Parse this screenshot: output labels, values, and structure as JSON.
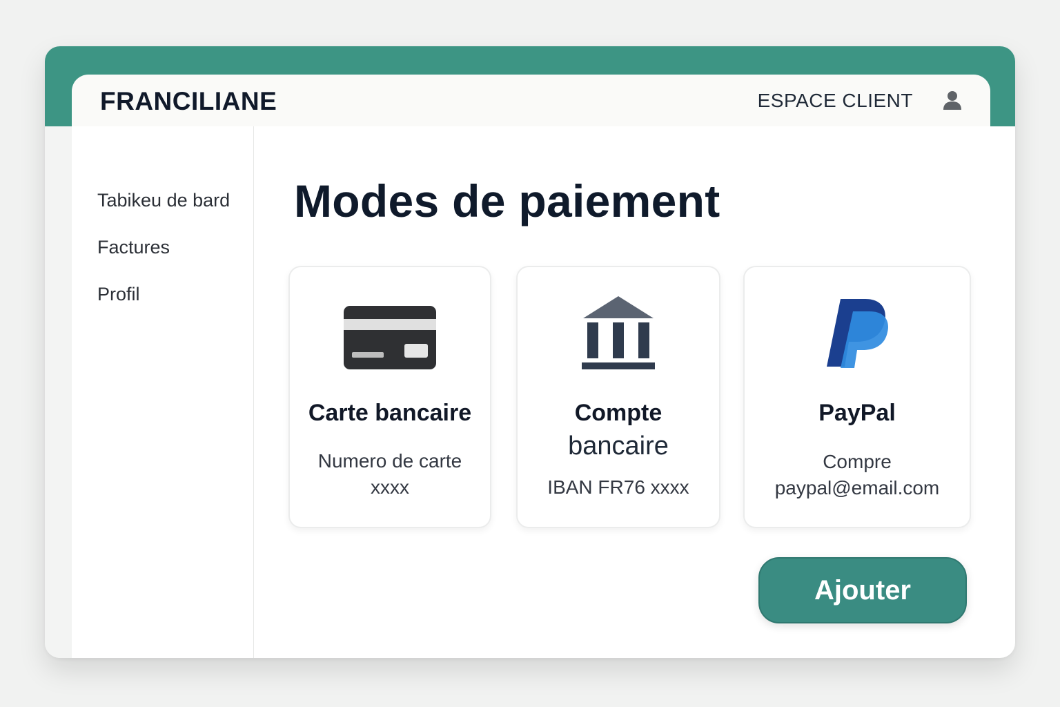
{
  "header": {
    "brand": "FRANCILIANE",
    "espace_client": "ESPACE CLIENT",
    "user_icon": "user-icon"
  },
  "sidebar": {
    "items": [
      {
        "label": "Tabikeu de bard"
      },
      {
        "label": "Factures"
      },
      {
        "label": "Profil"
      }
    ]
  },
  "main": {
    "title": "Modes de paiement",
    "cards": [
      {
        "icon": "credit-card-icon",
        "title": "Carte bancaire",
        "detail_line1": "Numero de carte",
        "detail_line2": "xxxx"
      },
      {
        "icon": "bank-icon",
        "title_line1": "Compte",
        "title_line2": "bancaire",
        "detail": "IBAN FR76 xxxx"
      },
      {
        "icon": "paypal-icon",
        "title": "PayPal",
        "detail_line1": "Compre",
        "detail_line2": "paypal@email.com"
      }
    ],
    "add_button": "Ajouter"
  },
  "colors": {
    "accent": "#3d9584",
    "button": "#3a8c82",
    "text_dark": "#0f1a2b"
  }
}
